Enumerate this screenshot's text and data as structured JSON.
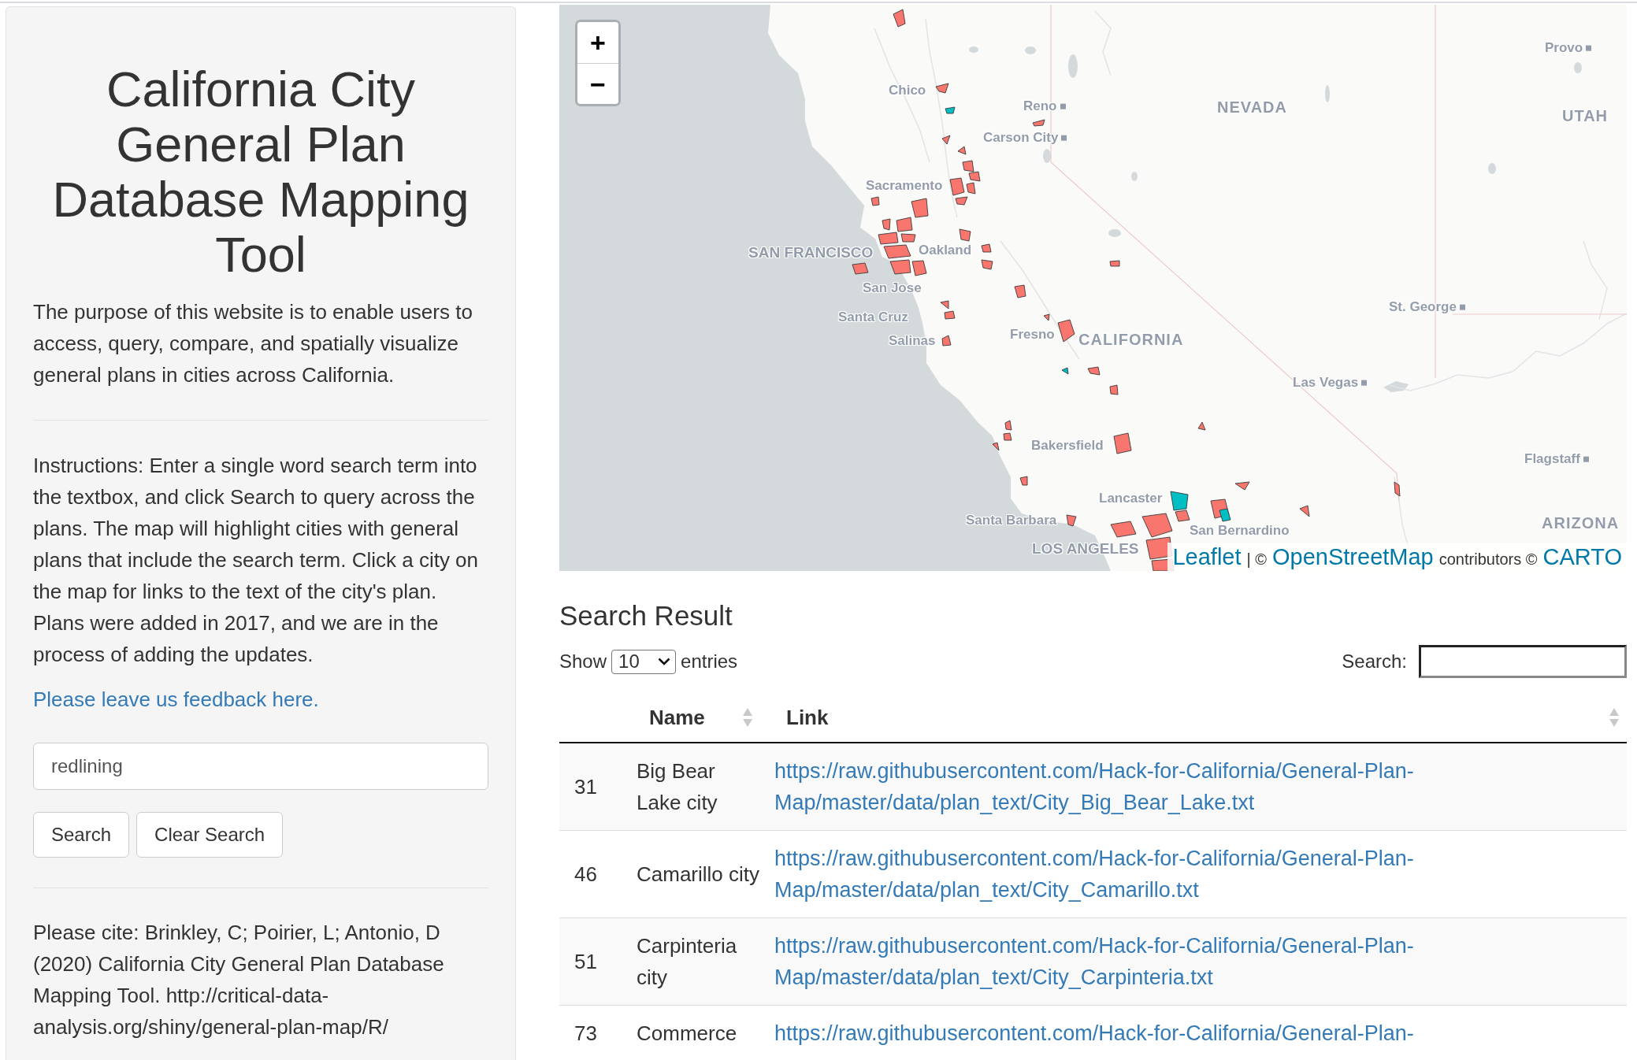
{
  "sidebar": {
    "title": "California City General Plan Database Mapping Tool",
    "intro": "The purpose of this website is to enable users to access, query, compare, and spatially visualize general plans in cities across California.",
    "instructions": "Instructions: Enter a single word search term into the textbox, and click Search to query across the plans. The map will highlight cities with general plans that include the search term. Click a city on the map for links to the text of the city's plan. Plans were added in 2017, and we are in the process of adding the updates.",
    "feedback_link": "Please leave us feedback here.",
    "search_field": {
      "value": "redlining"
    },
    "buttons": [
      "Search",
      "Clear Search"
    ],
    "citation": "Please cite: Brinkley, C; Poirier, L; Antonio, D (2020) California City General Plan Database Mapping Tool. http://critical-data-analysis.org/shiny/general-plan-map/R/"
  },
  "map": {
    "zoom_buttons": [
      "+",
      "−"
    ],
    "labels": [
      {
        "text": "Provo",
        "kind": "city"
      },
      {
        "text": "Chico",
        "kind": "town"
      },
      {
        "text": "Reno",
        "kind": "city"
      },
      {
        "text": "NEVADA",
        "kind": "state"
      },
      {
        "text": "UTAH",
        "kind": "state"
      },
      {
        "text": "Carson City",
        "kind": "city"
      },
      {
        "text": "Sacramento",
        "kind": "town"
      },
      {
        "text": "SAN FRANCISCO",
        "kind": "metro"
      },
      {
        "text": "Oakland",
        "kind": "town"
      },
      {
        "text": "San Jose",
        "kind": "town"
      },
      {
        "text": "St. George",
        "kind": "city"
      },
      {
        "text": "Santa Cruz",
        "kind": "town"
      },
      {
        "text": "Salinas",
        "kind": "town"
      },
      {
        "text": "Fresno",
        "kind": "town"
      },
      {
        "text": "CALIFORNIA",
        "kind": "state"
      },
      {
        "text": "Las Vegas",
        "kind": "city"
      },
      {
        "text": "Bakersfield",
        "kind": "town"
      },
      {
        "text": "Flagstaff",
        "kind": "city"
      },
      {
        "text": "Lancaster",
        "kind": "town"
      },
      {
        "text": "Santa Barbara",
        "kind": "town"
      },
      {
        "text": "San Bernardino",
        "kind": "town"
      },
      {
        "text": "ARIZONA",
        "kind": "state"
      },
      {
        "text": "LOS ANGELES",
        "kind": "metro"
      }
    ],
    "city_areas": [
      {
        "color": "#f8766d"
      },
      {
        "color": "#f8766d"
      },
      {
        "color": "#00bfc4"
      },
      {
        "color": "#f8766d"
      },
      {
        "color": "#f8766d"
      },
      {
        "color": "#f8766d"
      },
      {
        "color": "#f8766d"
      },
      {
        "color": "#f8766d"
      },
      {
        "color": "#f8766d"
      },
      {
        "color": "#f8766d"
      },
      {
        "color": "#f8766d"
      },
      {
        "color": "#f8766d"
      },
      {
        "color": "#f8766d"
      },
      {
        "color": "#f8766d"
      },
      {
        "color": "#f8766d"
      },
      {
        "color": "#f8766d"
      },
      {
        "color": "#f8766d"
      },
      {
        "color": "#f8766d"
      },
      {
        "color": "#f8766d"
      },
      {
        "color": "#f8766d"
      },
      {
        "color": "#f8766d"
      },
      {
        "color": "#f8766d"
      },
      {
        "color": "#f8766d"
      },
      {
        "color": "#f8766d"
      },
      {
        "color": "#f8766d"
      },
      {
        "color": "#f8766d"
      },
      {
        "color": "#f8766d"
      },
      {
        "color": "#f8766d"
      },
      {
        "color": "#f8766d"
      },
      {
        "color": "#f8766d"
      },
      {
        "color": "#f8766d"
      },
      {
        "color": "#00bfc4"
      },
      {
        "color": "#f8766d"
      },
      {
        "color": "#f8766d"
      },
      {
        "color": "#f8766d"
      },
      {
        "color": "#f8766d"
      },
      {
        "color": "#f8766d"
      },
      {
        "color": "#f8766d"
      },
      {
        "color": "#f8766d"
      },
      {
        "color": "#f8766d"
      },
      {
        "color": "#f8766d"
      },
      {
        "color": "#f8766d"
      },
      {
        "color": "#00bfc4"
      },
      {
        "color": "#f8766d"
      },
      {
        "color": "#f8766d"
      },
      {
        "color": "#00bfc4"
      },
      {
        "color": "#f8766d"
      },
      {
        "color": "#f8766d"
      },
      {
        "color": "#f8766d"
      },
      {
        "color": "#f8766d"
      },
      {
        "color": "#f8766d"
      },
      {
        "color": "#f8766d"
      }
    ],
    "attribution": [
      {
        "kind": "link",
        "text": "Leaflet"
      },
      {
        "kind": "text",
        "text": "| ©"
      },
      {
        "kind": "link",
        "text": "OpenStreetMap"
      },
      {
        "kind": "text",
        "text": "contributors ©"
      },
      {
        "kind": "link",
        "text": "CARTO"
      }
    ]
  },
  "results": {
    "title": "Search Result",
    "length_menu": {
      "before": "Show",
      "value": "10",
      "after": "entries"
    },
    "search_label": "Search:",
    "columns": [
      {
        "label": "Name",
        "sortable": true
      },
      {
        "label": "Link",
        "sortable": true
      }
    ],
    "rows": [
      {
        "column_1": "31",
        "name": "Big Bear Lake city",
        "link": "https://raw.githubusercontent.com/Hack-for-California/General-Plan-Map/master/data/plan_text/City_Big_Bear_Lake.txt"
      },
      {
        "column_1": "46",
        "name": "Camarillo city",
        "link": "https://raw.githubusercontent.com/Hack-for-California/General-Plan-Map/master/data/plan_text/City_Camarillo.txt"
      },
      {
        "column_1": "51",
        "name": "Carpinteria city",
        "link": "https://raw.githubusercontent.com/Hack-for-California/General-Plan-Map/master/data/plan_text/City_Carpinteria.txt"
      },
      {
        "column_1": "73",
        "name": "Commerce",
        "link": "https://raw.githubusercontent.com/Hack-for-California/General-Plan-"
      }
    ]
  }
}
